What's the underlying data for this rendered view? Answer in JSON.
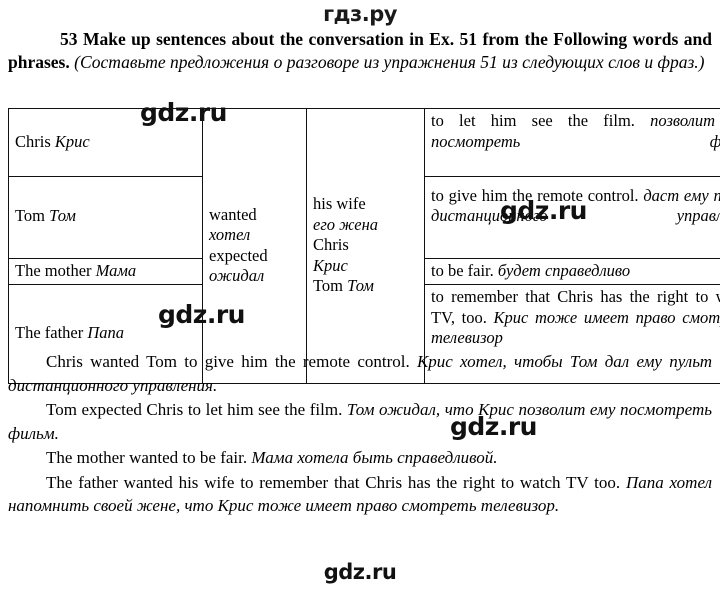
{
  "site": {
    "logo_top": "гдз.ру",
    "logo_bottom": "gdz.ru",
    "watermark_text": "gdz.ru"
  },
  "exercise": {
    "number": "53",
    "title_en": "53 Make up sentences about the conversation in Ex. 51 from the Following words and phrases.",
    "title_ru": "(Составьте предложения о разговоре из упражнения 51 из следующих слов и фраз.)"
  },
  "table": {
    "rows": [
      {
        "subject_en": "Chris",
        "subject_ru": "Крис",
        "infinitive_en": "to let him see the film.",
        "infinitive_ru": "позволит ему посмотреть фильм"
      },
      {
        "subject_en": "Tom",
        "subject_ru": "Том",
        "infinitive_en": "to give him the remote control.",
        "infinitive_ru": "даст ему пульт дистанционного управления"
      },
      {
        "subject_en": "The mother",
        "subject_ru": "Мама",
        "infinitive_en": "to be fair.",
        "infinitive_ru": "будет справедливо"
      },
      {
        "subject_en": "The father",
        "subject_ru": "Папа",
        "infinitive_en": "to remember that Chris has the right to watch TV, too.",
        "infinitive_ru": "Крис тоже имеет право смотреть телевизор"
      }
    ],
    "verbs": {
      "verb1_en": "wanted",
      "verb1_ru": "хотел",
      "verb2_en": "expected",
      "verb2_ru": "ожидал"
    },
    "objects": {
      "obj1_en": "his wife",
      "obj1_ru": "его жена",
      "obj2_en": "Chris",
      "obj2_ru": "Крис",
      "obj3_en": "Tom",
      "obj3_ru": "Том"
    }
  },
  "answers": [
    {
      "en": "Chris wanted Tom to give him the remote control.",
      "ru": "Крис хотел, чтобы Том дал ему пульт дистанционного управления."
    },
    {
      "en": "Tom expected Chris to let him see the film.",
      "ru": "Том ожидал, что Крис позволит ему посмотреть фильм."
    },
    {
      "en": "The mother wanted to be fair.",
      "ru": "Мама хотела быть справедливой."
    },
    {
      "en": "The father wanted his wife to remember that Chris has the right to watch TV too.",
      "ru": "Папа хотел напомнить своей жене, что Крис тоже имеет право смотреть телевизор."
    }
  ]
}
